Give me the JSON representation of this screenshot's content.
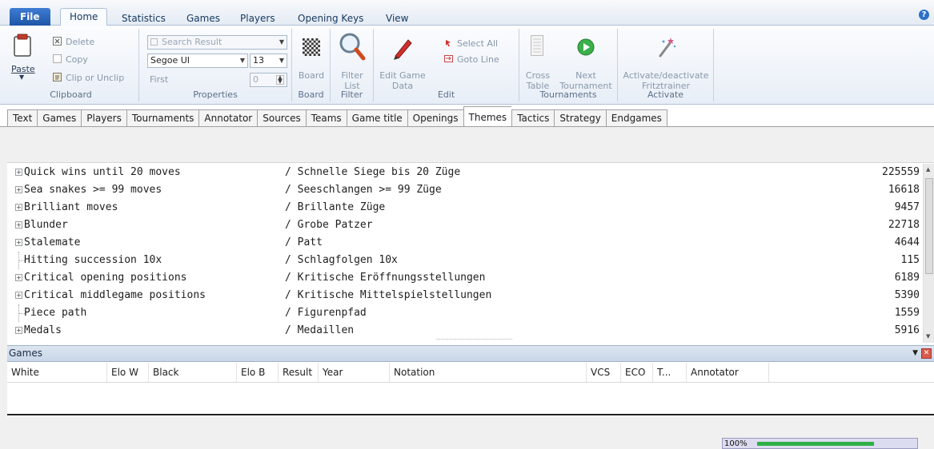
{
  "ribbon_tabs": [
    "File",
    "Home",
    "Statistics",
    "Games",
    "Players",
    "Opening Keys",
    "View"
  ],
  "active_ribbon_tab": "Home",
  "clipboard": {
    "paste": "Paste",
    "delete": "Delete",
    "copy": "Copy",
    "clip": "Clip or Unclip",
    "label": "Clipboard"
  },
  "properties": {
    "search_placeholder": "Search Result",
    "font": "Segoe UI",
    "size": "13",
    "first": "First",
    "first_value": "0",
    "label": "Properties"
  },
  "board_group": {
    "board": "Board",
    "label": "Board"
  },
  "filter_group": {
    "filter_line1": "Filter",
    "filter_line2": "List",
    "label": "Filter"
  },
  "edit_group": {
    "edit_line1": "Edit Game",
    "edit_line2": "Data",
    "select_all": "Select All",
    "goto_line": "Goto Line",
    "label": "Edit"
  },
  "tournaments_group": {
    "cross_line1": "Cross",
    "cross_line2": "Table",
    "next_line1": "Next",
    "next_line2": "Tournament",
    "label": "Tournaments"
  },
  "activate_group": {
    "line1": "Activate/deactivate",
    "line2": "Fritztrainer",
    "label": "Activate"
  },
  "sub_tabs": [
    "Text",
    "Games",
    "Players",
    "Tournaments",
    "Annotator",
    "Sources",
    "Teams",
    "Game title",
    "Openings",
    "Themes",
    "Tactics",
    "Strategy",
    "Endgames"
  ],
  "active_sub_tab": "Themes",
  "themes": [
    {
      "en": "Quick wins until 20 moves",
      "de": "/ Schnelle Siege bis 20 Züge",
      "count": "225559",
      "expandable": true
    },
    {
      "en": "Sea snakes >= 99 moves",
      "de": "/ Seeschlangen >= 99 Züge",
      "count": "16618",
      "expandable": true
    },
    {
      "en": "Brilliant moves",
      "de": "/ Brillante Züge",
      "count": "9457",
      "expandable": true
    },
    {
      "en": "Blunder",
      "de": "/ Grobe Patzer",
      "count": "22718",
      "expandable": true
    },
    {
      "en": "Stalemate",
      "de": "/ Patt",
      "count": "4644",
      "expandable": true
    },
    {
      "en": "Hitting succession 10x",
      "de": "/ Schlagfolgen 10x",
      "count": "115",
      "expandable": false
    },
    {
      "en": "Critical opening positions",
      "de": "/ Kritische Eröffnungsstellungen",
      "count": "6189",
      "expandable": true
    },
    {
      "en": "Critical middlegame positions",
      "de": "/ Kritische Mittelspielstellungen",
      "count": "5390",
      "expandable": true
    },
    {
      "en": "Piece path",
      "de": "/ Figurenpfad",
      "count": "1559",
      "expandable": false
    },
    {
      "en": "Medals",
      "de": "/ Medaillen",
      "count": "5916",
      "expandable": true
    }
  ],
  "games_pane": {
    "title": "Games",
    "columns": [
      "White",
      "Elo W",
      "Black",
      "Elo B",
      "Result",
      "Year",
      "Notation",
      "VCS",
      "ECO",
      "T...",
      "Annotator"
    ]
  },
  "status": {
    "progress_text": "100%",
    "progress_value": 0.75
  },
  "colors": {
    "file_tab": "#1d56a8",
    "progress_fill": "#2fb046",
    "close_button": "#d85c4c"
  },
  "icons": [
    "paste-icon",
    "delete-icon",
    "copy-icon",
    "clip-icon",
    "board-icon",
    "filter-icon",
    "edit-pen-icon",
    "select-all-icon",
    "goto-line-icon",
    "cross-table-icon",
    "next-tournament-icon",
    "magic-wand-icon",
    "help-icon"
  ]
}
